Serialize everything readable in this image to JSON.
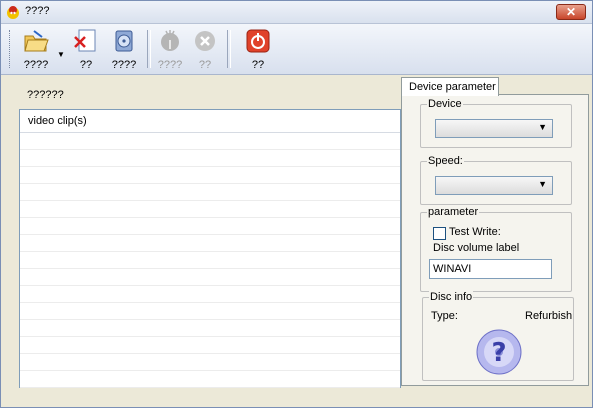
{
  "window": {
    "title": "????",
    "close_label": "✕"
  },
  "toolbar": {
    "buttons": [
      {
        "label": "????",
        "icon": "open-folder-icon",
        "enabled": true
      },
      {
        "label": "??",
        "icon": "delete-file-icon",
        "enabled": true
      },
      {
        "label": "????",
        "icon": "disc-settings-icon",
        "enabled": true
      },
      {
        "label": "????",
        "icon": "burn-disc-icon",
        "enabled": false
      },
      {
        "label": "??",
        "icon": "cancel-circle-icon",
        "enabled": false
      },
      {
        "label": "??",
        "icon": "power-exit-icon",
        "enabled": true
      }
    ]
  },
  "left": {
    "caption": "??????",
    "list_header": "video clip(s)"
  },
  "right": {
    "tab_label": "Device parameter",
    "device_group": "Device",
    "speed_group": "Speed:",
    "parameter_group": "parameter",
    "test_write_label": "Test Write:",
    "disc_volume_label": "Disc volume label",
    "disc_volume_value": "WINAVI",
    "disc_info_group": "Disc info",
    "type_label": "Type:",
    "type_value": "Refurbish"
  }
}
